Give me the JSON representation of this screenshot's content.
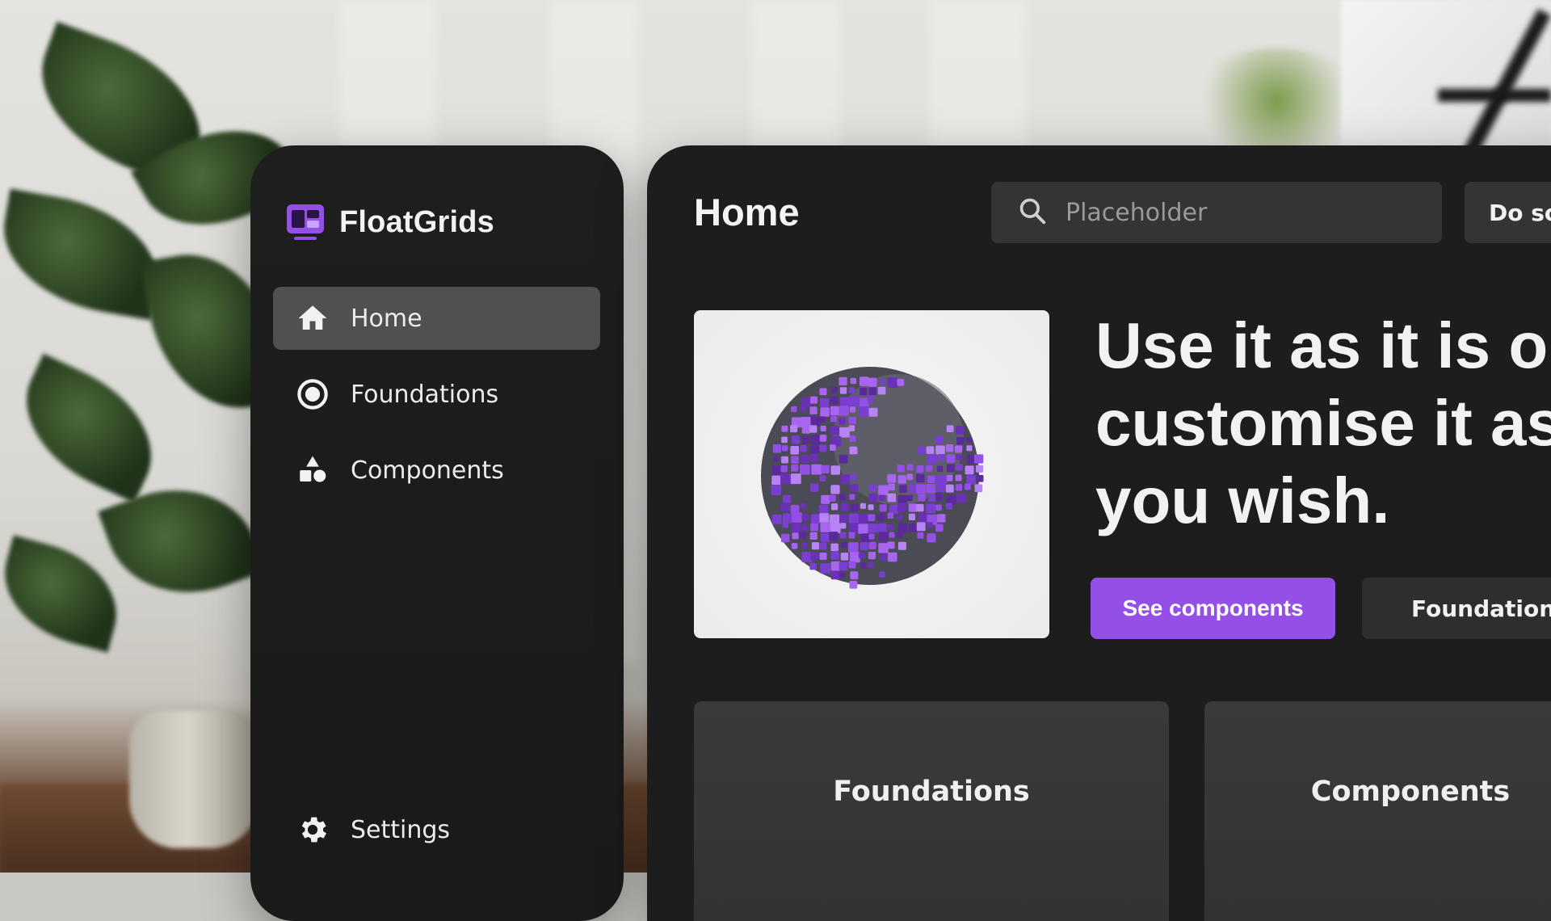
{
  "app": {
    "name": "FloatGrids",
    "accent_color": "#9450e6"
  },
  "sidebar": {
    "items": [
      {
        "label": "Home",
        "icon": "home-icon",
        "active": true
      },
      {
        "label": "Foundations",
        "icon": "radio-target-icon",
        "active": false
      },
      {
        "label": "Components",
        "icon": "shapes-icon",
        "active": false
      }
    ],
    "footer_item": {
      "label": "Settings",
      "icon": "gear-icon"
    }
  },
  "header": {
    "title": "Home",
    "search": {
      "placeholder": "Placeholder",
      "icon": "search-icon"
    },
    "action_label": "Do so"
  },
  "hero": {
    "image": "purple-voxel-sphere",
    "headline": [
      "Use it as it is o",
      "customise it as",
      "you wish."
    ],
    "primary_button": "See components",
    "secondary_button": "Foundations"
  },
  "cards": [
    {
      "label": "Foundations"
    },
    {
      "label": "Components"
    }
  ]
}
